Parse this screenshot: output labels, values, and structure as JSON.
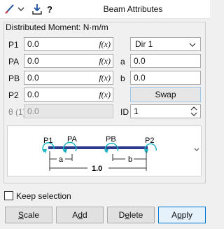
{
  "window": {
    "title": "Beam Attributes"
  },
  "toolbar": {
    "help_label": "?"
  },
  "group": {
    "title": "Distributed Moment: N·m/m"
  },
  "fields": {
    "p1": {
      "label": "P1",
      "value": "0.0"
    },
    "pa": {
      "label": "PA",
      "value": "0.0"
    },
    "pb": {
      "label": "PB",
      "value": "0.0"
    },
    "p2": {
      "label": "P2",
      "value": "0.0"
    },
    "theta": {
      "label": "θ (1)",
      "value": "0.0"
    },
    "a": {
      "label": "a",
      "value": "0.0"
    },
    "b": {
      "label": "b",
      "value": "0.0"
    },
    "id": {
      "label": "ID",
      "value": "1"
    },
    "fx_label": "f(x)"
  },
  "direction": {
    "selected": "Dir 1"
  },
  "swap_label": "Swap",
  "diagram": {
    "labels": {
      "p1": "P1",
      "pa": "PA",
      "pb": "PB",
      "p2": "P2",
      "a": "a",
      "b": "b",
      "length": "1.0"
    }
  },
  "keep_selection": {
    "label": "Keep selection",
    "checked": false
  },
  "buttons": {
    "scale": {
      "first": "S",
      "rest": "cale"
    },
    "add": {
      "pre": "A",
      "u": "d",
      "post": "d"
    },
    "delete": {
      "pre": "D",
      "u": "e",
      "post": "lete"
    },
    "apply": {
      "pre": "A",
      "u": "p",
      "post": "ply"
    }
  },
  "colors": {
    "beam": "#2b3a8c",
    "arrow": "#1fb5c5",
    "accent": "#0078d7"
  }
}
